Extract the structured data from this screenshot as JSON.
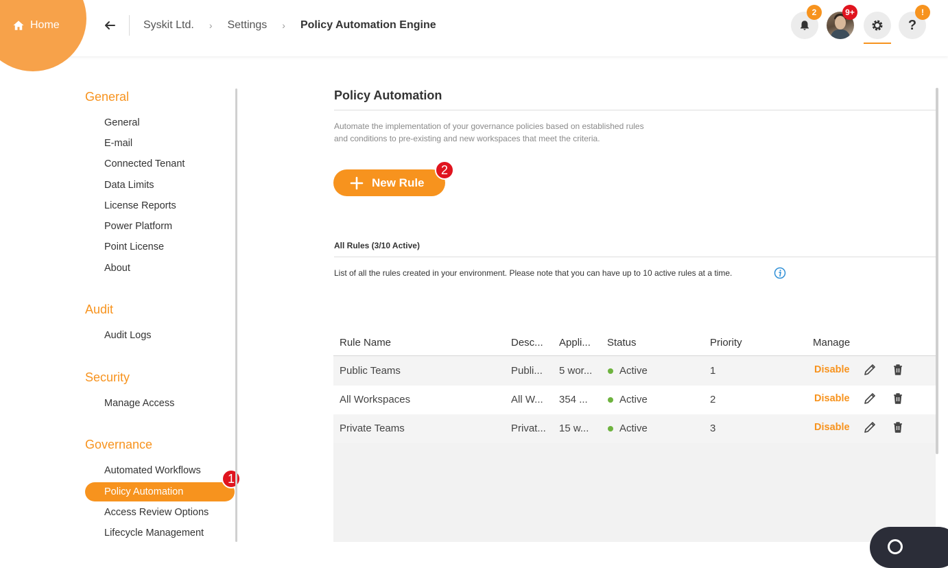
{
  "header": {
    "home_label": "Home",
    "breadcrumbs": [
      "Syskit Ltd.",
      "Settings"
    ],
    "current_page": "Policy Automation Engine",
    "notifications_badge": "2",
    "avatar_badge": "9+",
    "help_badge": "!",
    "colors": {
      "accent": "#f7931e",
      "badge_red": "#e0141e"
    }
  },
  "sidebar": {
    "sections": [
      {
        "title": "General",
        "items": [
          "General",
          "E-mail",
          "Connected Tenant",
          "Data Limits",
          "License Reports",
          "Power Platform",
          "Point License",
          "About"
        ]
      },
      {
        "title": "Audit",
        "items": [
          "Audit Logs"
        ]
      },
      {
        "title": "Security",
        "items": [
          "Manage Access"
        ]
      },
      {
        "title": "Governance",
        "items": [
          "Automated Workflows",
          "Policy Automation",
          "Access Review Options",
          "Lifecycle Management"
        ]
      }
    ],
    "active_item": "Policy Automation",
    "step_badge_1": "1"
  },
  "main": {
    "title": "Policy Automation",
    "description": "Automate the implementation of your governance policies based on established rules and conditions to pre-existing and new workspaces that meet the criteria.",
    "new_rule_label": "New Rule",
    "step_badge_2": "2",
    "rules_title": "All Rules (3/10 Active)",
    "rules_description": "List of all the rules created in your environment. Please note that you can have up to 10 active rules at a time."
  },
  "table": {
    "columns": [
      "Rule Name",
      "Desc...",
      "Appli...",
      "Status",
      "Priority",
      "Manage"
    ],
    "rows": [
      {
        "name": "Public Teams",
        "desc": "Publi...",
        "applies": "5 wor...",
        "status": "Active",
        "priority": "1",
        "action": "Disable"
      },
      {
        "name": "All Workspaces",
        "desc": "All W...",
        "applies": "354 ...",
        "status": "Active",
        "priority": "2",
        "action": "Disable"
      },
      {
        "name": "Private Teams",
        "desc": "Privat...",
        "applies": "15 w...",
        "status": "Active",
        "priority": "3",
        "action": "Disable"
      }
    ]
  }
}
